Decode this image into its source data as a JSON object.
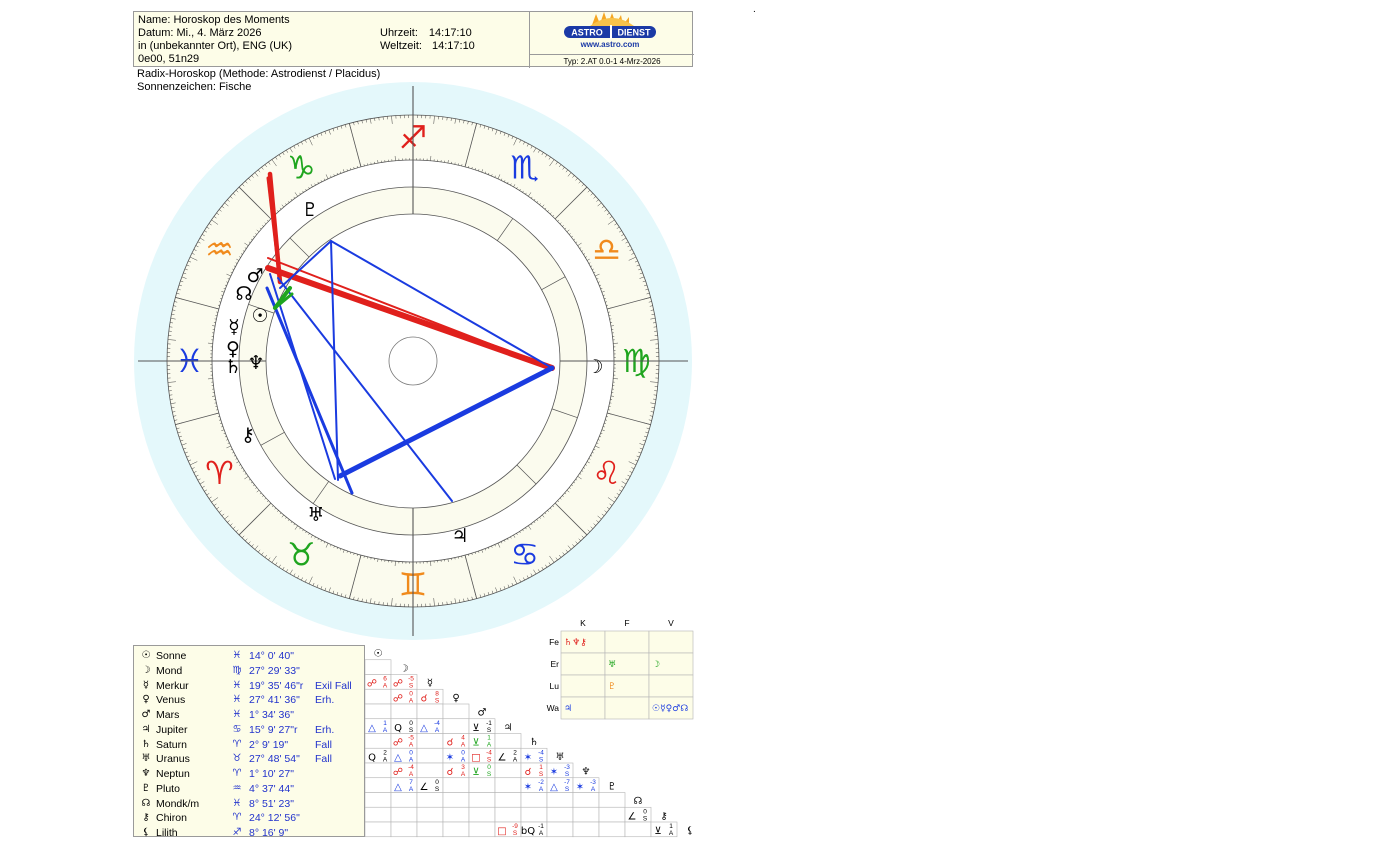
{
  "header": {
    "name_line": "Name: Horoskop des Moments",
    "date_line": "Datum: Mi., 4. März 2026",
    "place_line": "in (unbekannter Ort), ENG (UK)",
    "coords_line": "0e00, 51n29",
    "time_label": "Uhrzeit:",
    "time_value": "14:17:10",
    "ut_label": "Weltzeit:",
    "ut_value": "14:17:10",
    "logo_word_1": "ASTRO",
    "logo_word_2": "DIENST",
    "logo_url": "www.astro.com",
    "type_line": "Typ: 2.AT   0.0-1   4-Mrz-2026"
  },
  "subtitle": {
    "line1": "Radix-Horoskop  (Methode: Astrodienst / Placidus)",
    "line2": "Sonnenzeichen: Fische"
  },
  "corner_mark": ".",
  "planets": [
    {
      "glyph": "☉",
      "name": "Sonne",
      "sign": "♓",
      "pos": "14°   0' 40\"",
      "extra": ""
    },
    {
      "glyph": "☽",
      "name": "Mond",
      "sign": "♍",
      "pos": "27° 29' 33\"",
      "extra": ""
    },
    {
      "glyph": "☿",
      "name": "Merkur",
      "sign": "♓",
      "pos": "19° 35' 46\"r",
      "extra": "Exil Fall"
    },
    {
      "glyph": "♀",
      "name": "Venus",
      "sign": "♓",
      "pos": "27° 41' 36\"",
      "extra": "Erh."
    },
    {
      "glyph": "♂",
      "name": "Mars",
      "sign": "♓",
      "pos": "1° 34' 36\"",
      "extra": ""
    },
    {
      "glyph": "♃",
      "name": "Jupiter",
      "sign": "♋",
      "pos": "15°   9' 27\"r",
      "extra": "Erh."
    },
    {
      "glyph": "♄",
      "name": "Saturn",
      "sign": "♈",
      "pos": "2°   9' 19\"",
      "extra": "Fall"
    },
    {
      "glyph": "♅",
      "name": "Uranus",
      "sign": "♉",
      "pos": "27° 48' 54\"",
      "extra": "Fall"
    },
    {
      "glyph": "♆",
      "name": "Neptun",
      "sign": "♈",
      "pos": "1° 10' 27\"",
      "extra": ""
    },
    {
      "glyph": "♇",
      "name": "Pluto",
      "sign": "♒",
      "pos": "4° 37' 44\"",
      "extra": ""
    },
    {
      "glyph": "☊",
      "name": "Mondk/m",
      "sign": "♓",
      "pos": "8° 51' 23\"",
      "extra": ""
    },
    {
      "glyph": "⚷",
      "name": "Chiron",
      "sign": "♈",
      "pos": "24° 12' 56\"",
      "extra": ""
    },
    {
      "glyph": "⚸",
      "name": "Lilith",
      "sign": "♐",
      "pos": "8° 16'   9\"",
      "extra": ""
    }
  ],
  "zodiac": [
    {
      "glyph": "♈",
      "color": "#e0201c"
    },
    {
      "glyph": "♉",
      "color": "#1fa51f"
    },
    {
      "glyph": "♊",
      "color": "#f08a1c"
    },
    {
      "glyph": "♋",
      "color": "#1a3be0"
    },
    {
      "glyph": "♌",
      "color": "#e0201c"
    },
    {
      "glyph": "♍",
      "color": "#1fa51f"
    },
    {
      "glyph": "♎",
      "color": "#f08a1c"
    },
    {
      "glyph": "♏",
      "color": "#1a3be0"
    },
    {
      "glyph": "♐",
      "color": "#e0201c"
    },
    {
      "glyph": "♑",
      "color": "#1fa51f"
    },
    {
      "glyph": "♒",
      "color": "#f08a1c"
    },
    {
      "glyph": "♓",
      "color": "#1a3be0"
    }
  ],
  "chart_planets": [
    {
      "glyph": "♇"
    },
    {
      "glyph": "♂"
    },
    {
      "glyph": "☊"
    },
    {
      "glyph": "☉"
    },
    {
      "glyph": "☿"
    },
    {
      "glyph": "♀"
    },
    {
      "glyph": "♄"
    },
    {
      "glyph": "♆"
    },
    {
      "glyph": "⚷"
    },
    {
      "glyph": "☽"
    },
    {
      "glyph": "♅"
    },
    {
      "glyph": "♃"
    }
  ],
  "elements": {
    "cols": [
      "K",
      "F",
      "V"
    ],
    "rows": [
      {
        "label": "Fe",
        "cells": [
          {
            "text": "♄♆⚷",
            "color": "#e0201c"
          },
          {
            "text": "",
            "color": "#000"
          },
          {
            "text": "",
            "color": "#000"
          }
        ]
      },
      {
        "label": "Er",
        "cells": [
          {
            "text": "",
            "color": "#000"
          },
          {
            "text": "♅",
            "color": "#1fa51f"
          },
          {
            "text": "☽",
            "color": "#1fa51f"
          }
        ]
      },
      {
        "label": "Lu",
        "cells": [
          {
            "text": "",
            "color": "#000"
          },
          {
            "text": "♇",
            "color": "#f08a1c"
          },
          {
            "text": "",
            "color": "#000"
          }
        ]
      },
      {
        "label": "Wa",
        "cells": [
          {
            "text": "♃",
            "color": "#1a3be0"
          },
          {
            "text": "",
            "color": "#000"
          },
          {
            "text": "☉☿♀♂☊",
            "color": "#1a3be0"
          }
        ]
      }
    ]
  },
  "aspect_grid": {
    "diag": [
      "☉",
      "☽",
      "☿",
      "♀",
      "♂",
      "♃",
      "♄",
      "♅",
      "♆",
      "♇",
      "☊",
      "⚷",
      "⚸"
    ],
    "cells": [
      {
        "r": 2,
        "c": 0,
        "sym": "☍",
        "orb": "6",
        "q": "A",
        "color": "#e0201c"
      },
      {
        "r": 2,
        "c": 1,
        "sym": "☍",
        "orb": "-5",
        "q": "S",
        "color": "#e0201c"
      },
      {
        "r": 3,
        "c": 1,
        "sym": "☍",
        "orb": "0",
        "q": "A",
        "color": "#e0201c"
      },
      {
        "r": 3,
        "c": 2,
        "sym": "☌",
        "orb": "8",
        "q": "S",
        "color": "#e0201c"
      },
      {
        "r": 5,
        "c": 0,
        "sym": "△",
        "orb": "1",
        "q": "A",
        "color": "#1a3be0"
      },
      {
        "r": 5,
        "c": 1,
        "sym": "Q",
        "orb": "0",
        "q": "S",
        "color": "#000000"
      },
      {
        "r": 5,
        "c": 2,
        "sym": "△",
        "orb": "-4",
        "q": "A",
        "color": "#1a3be0"
      },
      {
        "r": 5,
        "c": 4,
        "sym": "⊻",
        "orb": "-1",
        "q": "S",
        "color": "#000000"
      },
      {
        "r": 6,
        "c": 1,
        "sym": "☍",
        "orb": "-5",
        "q": "A",
        "color": "#e0201c"
      },
      {
        "r": 6,
        "c": 3,
        "sym": "☌",
        "orb": "4",
        "q": "A",
        "color": "#e0201c"
      },
      {
        "r": 6,
        "c": 4,
        "sym": "⊻",
        "orb": "1",
        "q": "A",
        "color": "#1fa51f"
      },
      {
        "r": 7,
        "c": 0,
        "sym": "Q",
        "orb": "2",
        "q": "A",
        "color": "#000000"
      },
      {
        "r": 7,
        "c": 1,
        "sym": "△",
        "orb": "0",
        "q": "A",
        "color": "#1a3be0"
      },
      {
        "r": 7,
        "c": 3,
        "sym": "✶",
        "orb": "0",
        "q": "A",
        "color": "#1a3be0"
      },
      {
        "r": 7,
        "c": 4,
        "sym": "□",
        "orb": "-4",
        "q": "S",
        "color": "#e0201c"
      },
      {
        "r": 7,
        "c": 5,
        "sym": "∠",
        "orb": "2",
        "q": "A",
        "color": "#000000"
      },
      {
        "r": 7,
        "c": 6,
        "sym": "✶",
        "orb": "-4",
        "q": "S",
        "color": "#1a3be0"
      },
      {
        "r": 8,
        "c": 1,
        "sym": "☍",
        "orb": "-4",
        "q": "A",
        "color": "#e0201c"
      },
      {
        "r": 8,
        "c": 3,
        "sym": "☌",
        "orb": "3",
        "q": "A",
        "color": "#e0201c"
      },
      {
        "r": 8,
        "c": 4,
        "sym": "⊻",
        "orb": "0",
        "q": "S",
        "color": "#1fa51f"
      },
      {
        "r": 8,
        "c": 6,
        "sym": "☌",
        "orb": "1",
        "q": "S",
        "color": "#e0201c"
      },
      {
        "r": 8,
        "c": 7,
        "sym": "✶",
        "orb": "-3",
        "q": "S",
        "color": "#1a3be0"
      },
      {
        "r": 9,
        "c": 1,
        "sym": "△",
        "orb": "7",
        "q": "A",
        "color": "#1a3be0"
      },
      {
        "r": 9,
        "c": 2,
        "sym": "∠",
        "orb": "0",
        "q": "S",
        "color": "#000000"
      },
      {
        "r": 9,
        "c": 6,
        "sym": "✶",
        "orb": "-2",
        "q": "A",
        "color": "#1a3be0"
      },
      {
        "r": 9,
        "c": 7,
        "sym": "△",
        "orb": "-7",
        "q": "S",
        "color": "#1a3be0"
      },
      {
        "r": 9,
        "c": 8,
        "sym": "✶",
        "orb": "-3",
        "q": "A",
        "color": "#1a3be0"
      },
      {
        "r": 11,
        "c": 10,
        "sym": "∠",
        "orb": "0",
        "q": "S",
        "color": "#000000"
      },
      {
        "r": 12,
        "c": 5,
        "sym": "□",
        "orb": "-9",
        "q": "S",
        "color": "#e0201c"
      },
      {
        "r": 12,
        "c": 6,
        "sym": "bQ",
        "orb": "-1",
        "q": "A",
        "color": "#000000"
      },
      {
        "r": 12,
        "c": 11,
        "sym": "⊻",
        "orb": "1",
        "q": "A",
        "color": "#000000"
      }
    ]
  }
}
